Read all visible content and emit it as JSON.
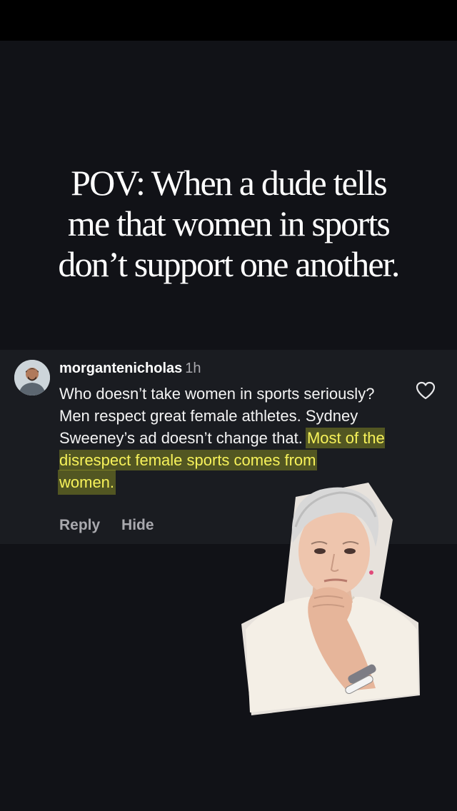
{
  "overlay": {
    "headline_lines": [
      "POV: When a dude tells",
      "me that women in sports",
      "don’t support one another."
    ]
  },
  "comment": {
    "username": "morgantenicholas",
    "time": "1h",
    "text_plain": "Who doesn’t take women in sports seriously? Men respect great female athletes. Sydney Sweeney’s ad doesn’t change that. ",
    "text_highlight_1": "Most of the disrespect female sports comes from",
    "text_highlight_2": "women.",
    "reply_label": "Reply",
    "hide_label": "Hide",
    "like_icon": "heart-outline-icon"
  },
  "colors": {
    "background": "#111217",
    "card": "#1a1c21",
    "highlight": "#f7f25a",
    "muted": "#a9a9ae"
  }
}
